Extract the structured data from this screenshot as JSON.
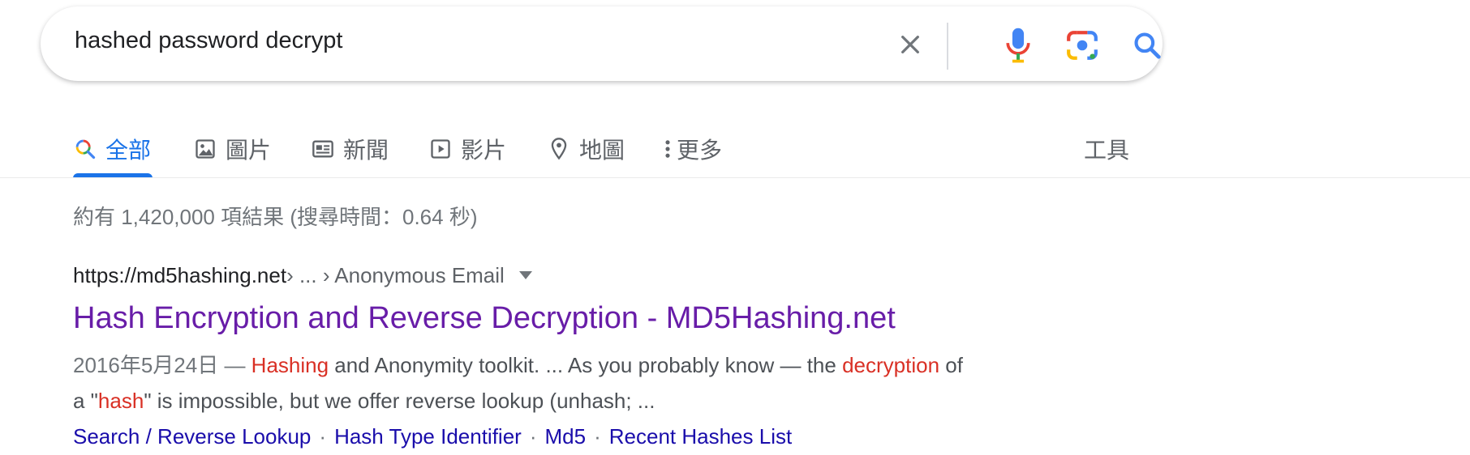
{
  "search": {
    "query": "hashed password decrypt",
    "clear_icon": "close-icon",
    "voice_icon": "microphone-icon",
    "lens_icon": "camera-lens-icon",
    "search_icon": "magnifier-icon"
  },
  "tabs": [
    {
      "label": "全部",
      "icon": "multicolor-search-icon",
      "active": true
    },
    {
      "label": "圖片",
      "icon": "image-icon"
    },
    {
      "label": "新聞",
      "icon": "newspaper-icon"
    },
    {
      "label": "影片",
      "icon": "play-icon"
    },
    {
      "label": "地圖",
      "icon": "location-pin-icon"
    },
    {
      "label": "更多",
      "icon": "more-vert-icon"
    }
  ],
  "tools_label": "工具",
  "stats": "約有 1,420,000 項結果 (搜尋時間：0.64 秒)",
  "result": {
    "site": "https://md5hashing.net",
    "path": " › ... › Anonymous Email",
    "title": "Hash Encryption and Reverse Decryption - MD5Hashing.net",
    "snippet": {
      "date": "2016年5月24日 — ",
      "hl1": "Hashing",
      "t1": " and Anonymity toolkit. ... As you probably know — the ",
      "hl2": "decryption",
      "t2": " of",
      "t3": "a \"",
      "hl3": "hash",
      "t4": "\" is impossible, but we offer reverse lookup (unhash; ..."
    },
    "sitelinks": [
      "Search / Reverse Lookup",
      "Hash Type Identifier",
      "Md5",
      "Recent Hashes List"
    ],
    "separator": "·"
  },
  "colors": {
    "accent": "#1a73e8",
    "visited_title": "#681da8",
    "link": "#1a0dab",
    "highlight": "#d93025"
  }
}
